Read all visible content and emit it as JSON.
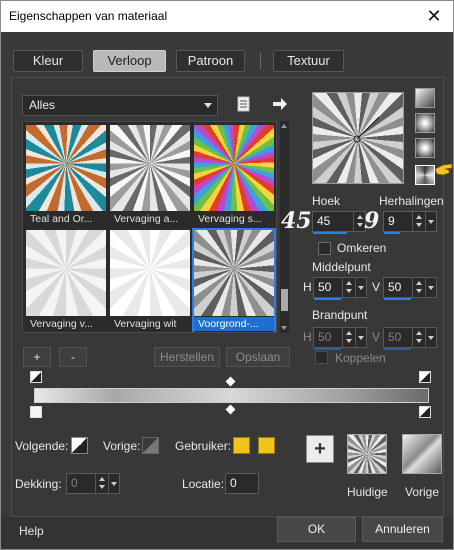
{
  "window": {
    "title": "Eigenschappen van materiaal",
    "close_glyph": "✕"
  },
  "tabs": [
    {
      "label": "Kleur",
      "active": false
    },
    {
      "label": "Verloop",
      "active": true
    },
    {
      "label": "Patroon",
      "active": false
    },
    {
      "label": "Textuur",
      "active": false
    }
  ],
  "library": {
    "category": "Alles",
    "icons": [
      "document-icon",
      "arrow-right-icon"
    ],
    "thumbnails": [
      {
        "caption": "Teal and Or...",
        "selected": false
      },
      {
        "caption": "Vervaging a...",
        "selected": false
      },
      {
        "caption": "Vervaging s...",
        "selected": false
      },
      {
        "caption": "Vervaging v...",
        "selected": false
      },
      {
        "caption": "Vervaging wit",
        "selected": false
      },
      {
        "caption": "Voorgrond-...",
        "selected": true
      }
    ],
    "add_label": "+",
    "remove_label": "-",
    "restore_label": "Herstellen",
    "save_label": "Opslaan"
  },
  "settings": {
    "angle_label": "Hoek",
    "angle_value": "45",
    "repeats_label": "Herhalingen",
    "repeats_value": "9",
    "overlay_angle": "45",
    "overlay_repeats": "9",
    "invert_label": "Omkeren",
    "center_label": "Middelpunt",
    "center_h_label": "H",
    "center_h_value": "50",
    "center_v_label": "V",
    "center_v_value": "50",
    "focal_label": "Brandpunt",
    "focal_h_label": "H",
    "focal_h_value": "50",
    "focal_v_label": "V",
    "focal_v_value": "50",
    "link_label": "Koppelen"
  },
  "stops": {
    "next_label": "Volgende:",
    "prev_label": "Vorige:",
    "user_label": "Gebruiker:",
    "user_color": "#f2c31b",
    "opacity_label": "Dekking:",
    "opacity_value": "0",
    "location_label": "Locatie:",
    "location_value": "0"
  },
  "swatches": {
    "add_label": "+",
    "current_label": "Huidige",
    "previous_label": "Vorige"
  },
  "footer": {
    "help_label": "Help",
    "ok_label": "OK",
    "cancel_label": "Annuleren"
  }
}
